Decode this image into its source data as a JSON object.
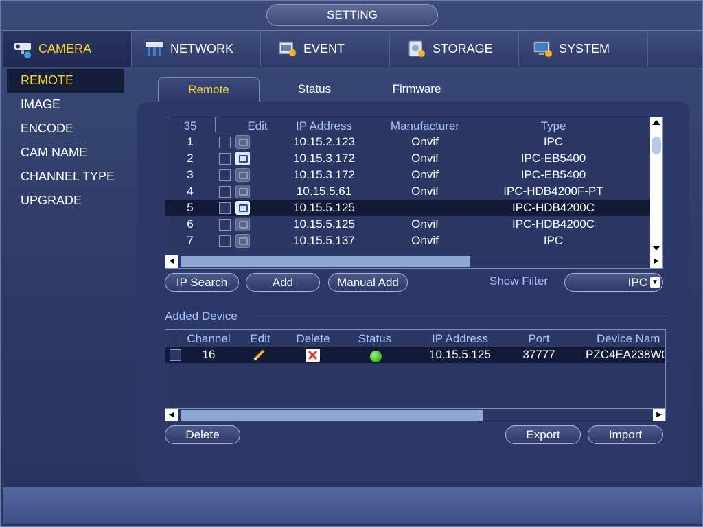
{
  "window": {
    "title": "SETTING"
  },
  "top_tabs": [
    {
      "label": "CAMERA",
      "icon": "camera-icon",
      "active": true
    },
    {
      "label": "NETWORK",
      "icon": "network-icon"
    },
    {
      "label": "EVENT",
      "icon": "event-icon"
    },
    {
      "label": "STORAGE",
      "icon": "storage-icon"
    },
    {
      "label": "SYSTEM",
      "icon": "system-icon"
    }
  ],
  "left_menu": [
    {
      "label": "REMOTE",
      "active": true
    },
    {
      "label": "IMAGE"
    },
    {
      "label": "ENCODE"
    },
    {
      "label": "CAM NAME"
    },
    {
      "label": "CHANNEL TYPE"
    },
    {
      "label": "UPGRADE"
    }
  ],
  "sub_tabs": [
    {
      "label": "Remote",
      "active": true
    },
    {
      "label": "Status"
    },
    {
      "label": "Firmware"
    }
  ],
  "search_table": {
    "count": "35",
    "headers": {
      "edit": "Edit",
      "ip": "IP Address",
      "manufacturer": "Manufacturer",
      "type": "Type"
    },
    "rows": [
      {
        "no": "1",
        "ip": "10.15.2.123",
        "manufacturer": "Onvif",
        "type": "IPC"
      },
      {
        "no": "2",
        "ip": "10.15.3.172",
        "manufacturer": "Onvif",
        "type": "IPC-EB5400"
      },
      {
        "no": "3",
        "ip": "10.15.3.172",
        "manufacturer": "Onvif",
        "type": "IPC-EB5400"
      },
      {
        "no": "4",
        "ip": "10.15.5.61",
        "manufacturer": "Onvif",
        "type": "IPC-HDB4200F-PT"
      },
      {
        "no": "5",
        "ip": "10.15.5.125",
        "manufacturer": "",
        "type": "IPC-HDB4200C"
      },
      {
        "no": "6",
        "ip": "10.15.5.125",
        "manufacturer": "Onvif",
        "type": "IPC-HDB4200C"
      },
      {
        "no": "7",
        "ip": "10.15.5.137",
        "manufacturer": "Onvif",
        "type": "IPC"
      }
    ]
  },
  "buttons": {
    "ip_search": "IP Search",
    "add": "Add",
    "manual_add": "Manual Add",
    "delete": "Delete",
    "export": "Export",
    "import": "Import"
  },
  "filter": {
    "label": "Show Filter",
    "value": "IPC"
  },
  "added_device": {
    "title": "Added Device",
    "headers": {
      "channel": "Channel",
      "edit": "Edit",
      "delete": "Delete",
      "status": "Status",
      "ip": "IP Address",
      "port": "Port",
      "device_name": "Device Nam"
    },
    "rows": [
      {
        "channel": "16",
        "ip": "10.15.5.125",
        "port": "37777",
        "device_name": "PZC4EA238W0"
      }
    ]
  },
  "colors": {
    "accent": "#f5d52a",
    "header_text": "#a9c4ff",
    "status_ok": "#3ec22a",
    "delete_icon": "#e03a2a"
  }
}
